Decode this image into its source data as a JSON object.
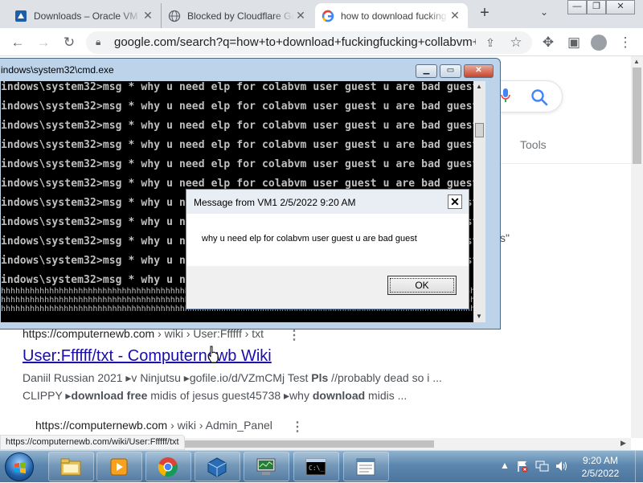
{
  "browser": {
    "tabs": [
      {
        "title": "Downloads – Oracle VM V",
        "favicon": "virtualbox-icon"
      },
      {
        "title": "Blocked by Cloudflare Gat",
        "favicon": "globe-icon"
      },
      {
        "title": "how to download fucking",
        "favicon": "google-g-icon",
        "active": true
      }
    ],
    "url": "google.com/search?q=how+to+download+fuckingfucking+collabvm+f..."
  },
  "google": {
    "tools_label": "Tools",
    "fragment": "s\"",
    "results": [
      {
        "site": "https://computernewb.com",
        "path": " › wiki › User:Ffffff › txt",
        "title": "User:Ffffff/txt - Computernewb Wiki",
        "snippet1": "Daniil Russian 2021 ▸v Ninjutsu ▸gofile.io/d/VZmCMj Test ",
        "snippet1_bold": "Pls",
        "snippet1_tail": " //probably dead so i ...",
        "snippet2_a": "CLIPPY ▸",
        "snippet2_bold1": "download free",
        "snippet2_mid": " midis of jesus guest45738 ▸why ",
        "snippet2_bold2": "download",
        "snippet2_tail": " midis ..."
      },
      {
        "site": "https://computernewb.com",
        "path": " › wiki › Admin_Panel"
      }
    ],
    "status_url": "https://computernewb.com/wiki/User:Ffffff/txt"
  },
  "cmd": {
    "title": "indows\\system32\\cmd.exe",
    "lines": [
      "indows\\system32>msg * why u need elp for colabvm user guest u are bad guest",
      "indows\\system32>msg * why u need elp for colabvm user guest u are bad guest",
      "indows\\system32>msg * why u need elp for colabvm user guest u are bad guest",
      "indows\\system32>msg * why u need elp for colabvm user guest u are bad guest",
      "indows\\system32>msg * why u need elp for colabvm user guest u are bad guest",
      "indows\\system32>msg * why u need elp for colabvm user guest u are bad guest",
      "indows\\system32>msg * why u need elp for colabvm user guest u are bad guest",
      "indows\\system32>msg * why u need elp for colabvm user guest u are bad guest",
      "indows\\system32>msg * why u need elp for colabvm user guest u are bad guest",
      "indows\\system32>msg * why u need elp for colabvm user guest u are bad guest",
      "indows\\system32>msg * why u nee"
    ],
    "hlines": [
      "hhhhhhhhhhhhhhhhhhhhhhhhhhhhhhhhhhhhhhhhhhhhhhhhhhhhhhhhhhhhhhhhhhhhhhhhhhhhhhhhhhhhhhhhhhhhhhhhhhhhhhhh",
      "hhhhhhhhhhhhhhhhhhhhhhhhhhhhhhhhhhhhhhhhhhhhhhhhhhhhhhhhhhhhhhhhhhhhhhhhhhhhhhhhhhhhhhhhhhhhhhhhhhhhhhhh",
      "hhhhhhhhhhhhhhhhhhhhhhhhhhhhhhhhhhhhhhhhhhhhhhhhhhhhhhhhhhhhhhhhhhhhhhhhhhhhhhhhhhhhhhhhhhhhhhhhhhhhhhhh"
    ],
    "right_fragments": [
      "t",
      "t",
      "t"
    ]
  },
  "dialog": {
    "title": "Message from VM1 2/5/2022 9:20 AM",
    "message": "why u need elp for colabvm user guest u are bad guest",
    "ok_label": "OK",
    "close_glyph": "✕"
  },
  "taskbar": {
    "time": "9:20 AM",
    "date": "2/5/2022",
    "apps": [
      "explorer-icon",
      "media-player-icon",
      "chrome-icon",
      "virtualbox-icon",
      "network-monitor-icon",
      "cmd-icon",
      "window-app-icon"
    ]
  }
}
